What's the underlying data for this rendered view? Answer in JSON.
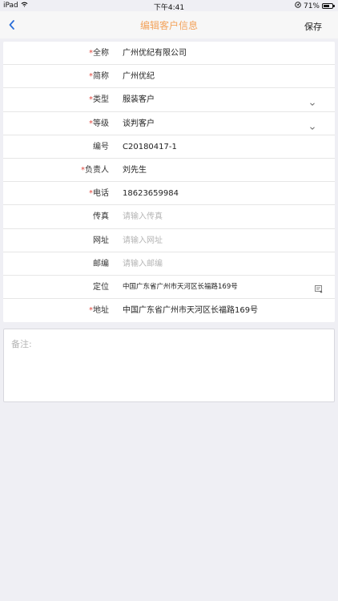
{
  "status_bar": {
    "device": "iPad",
    "time": "下午4:41",
    "battery": "71%",
    "battery_level": 0.71
  },
  "nav": {
    "title": "编辑客户信息",
    "save_label": "保存",
    "back_icon": "chevron-left-icon"
  },
  "colors": {
    "accent": "#f3a35c",
    "required_star": "#e0483e",
    "placeholder": "#b5b5b5",
    "background": "#efeff4"
  },
  "form": {
    "full_name": {
      "label": "全称",
      "value": "广州优纪有限公司"
    },
    "short_name": {
      "label": "简称",
      "value": "广州优纪"
    },
    "type": {
      "label": "类型",
      "value": "服装客户"
    },
    "level": {
      "label": "等级",
      "value": "谈判客户"
    },
    "code": {
      "label": "编号",
      "value": "C20180417-1"
    },
    "owner": {
      "label": "负责人",
      "value": "刘先生"
    },
    "phone": {
      "label": "电话",
      "value": "18623659984"
    },
    "fax": {
      "label": "传真",
      "placeholder": "请输入传真"
    },
    "website": {
      "label": "网址",
      "placeholder": "请输入网址"
    },
    "postcode": {
      "label": "邮编",
      "placeholder": "请输入邮编"
    },
    "location": {
      "label": "定位",
      "value": "中国广东省广州市天河区长福路169号"
    },
    "address": {
      "label": "地址",
      "value": "中国广东省广州市天河区长福路169号"
    }
  },
  "remark": {
    "placeholder": "备注:"
  }
}
